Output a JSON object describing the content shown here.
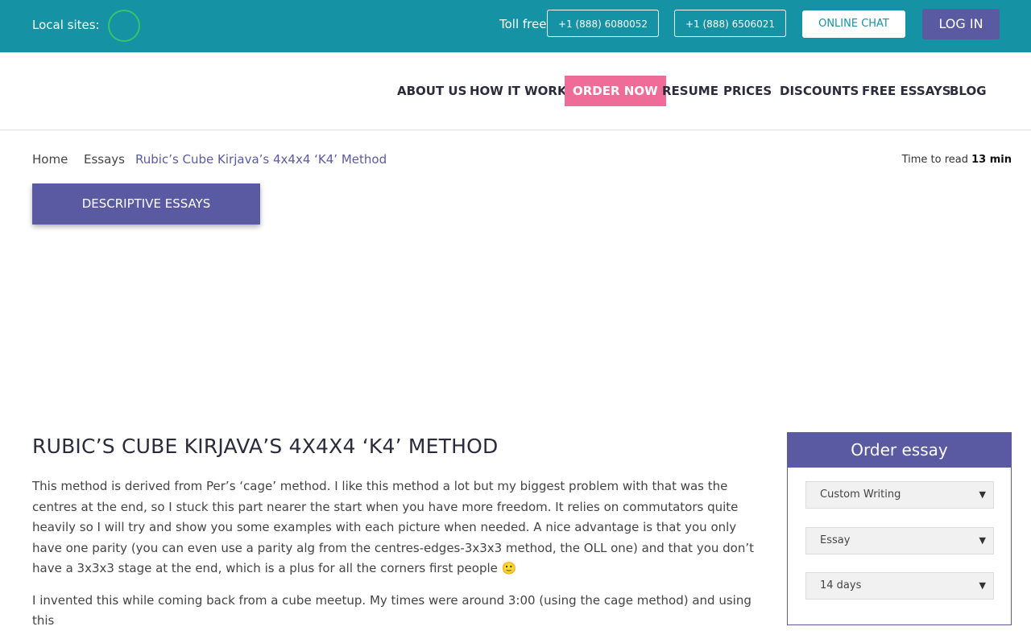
{
  "topbar": {
    "local_label": "Local sites:",
    "toll_label": "Toll free",
    "phone1": "+1 (888) 6080052",
    "phone2": "+1 (888) 6506021",
    "chat_label": "ONLINE CHAT",
    "login_label": "LOG IN"
  },
  "nav": {
    "items": [
      "ABOUT US",
      "HOW IT WORKS",
      "ORDER NOW",
      "RESUME",
      "PRICES",
      "DISCOUNTS",
      "FREE ESSAYS",
      "BLOG"
    ]
  },
  "breadcrumb": {
    "home": "Home",
    "essays": "Essays",
    "current": "Rubic’s Cube Kirjava’s 4x4x4 ‘K4’ Method"
  },
  "read_time": {
    "label": "Time to read",
    "value": "13 min"
  },
  "category_label": "DESCRIPTIVE ESSAYS",
  "article": {
    "title": "RUBIC’S CUBE KIRJAVA’S 4X4X4 ‘K4’ METHOD",
    "paragraph1": "This method is derived from Per’s ‘cage’ method. I like this method a lot but my biggest problem with that was the centres at the end, so I stuck this part nearer the start when you have more freedom. It relies on commutators quite heavily so I will try and show you some examples with each picture when needed. A nice advantage is that you only have one parity (you can even use a parity alg from the centres-edges-3x3x3 method, the OLL one) and that you don’t have a 3x3x3 stage at the end, which is a plus for all the corners first people 🙂",
    "paragraph2": "I invented this while coming back from a cube meetup. My times were around 3:00 (using the cage method) and using this"
  },
  "order": {
    "title": "Order essay",
    "service": "Custom Writing",
    "type": "Essay",
    "deadline": "14 days"
  },
  "colors": {
    "topbar": "#1592a3",
    "accent": "#5a5aa3",
    "order_now": "#f06c98",
    "globe": "#37c36b"
  }
}
